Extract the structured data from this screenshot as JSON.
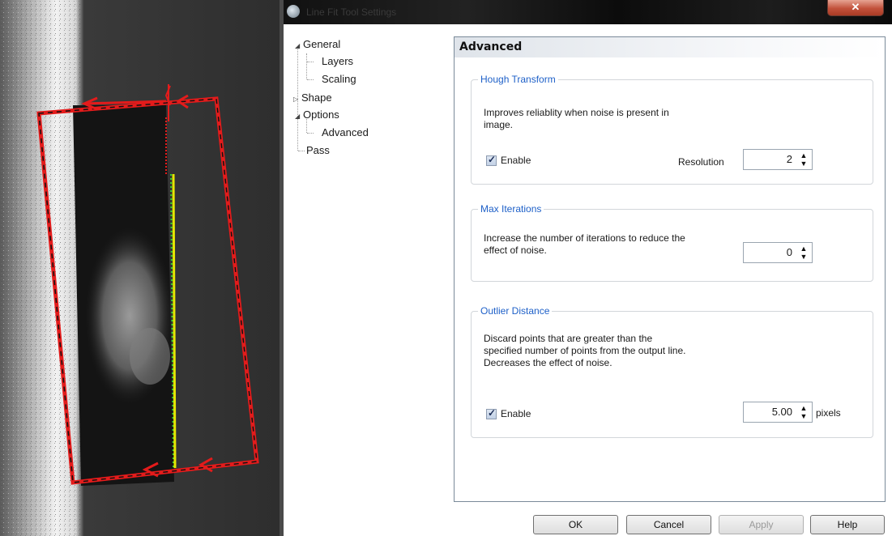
{
  "window": {
    "title": "Line Fit Tool Settings"
  },
  "tree": {
    "items": [
      {
        "label": "General",
        "expanded": true
      },
      {
        "label": "Layers"
      },
      {
        "label": "Scaling"
      },
      {
        "label": "Shape",
        "expanded": false
      },
      {
        "label": "Options",
        "expanded": true
      },
      {
        "label": "Advanced"
      },
      {
        "label": "Pass"
      }
    ]
  },
  "panel": {
    "title": "Advanced",
    "hough": {
      "title": "Hough Transform",
      "description_line1": "Improves reliablity when noise is present in",
      "description_line2": "image.",
      "enable_label": "Enable",
      "enable_checked": true,
      "resolution_label": "Resolution",
      "resolution_value": "2"
    },
    "max_iterations": {
      "title": "Max Iterations",
      "description_line1": "Increase the number of iterations to reduce the",
      "description_line2": "effect of noise.",
      "value": "0"
    },
    "outlier": {
      "title": "Outlier Distance",
      "description_line1": "Discard points that are greater than the",
      "description_line2": "specified number of points from the output line.",
      "description_line3": "Decreases the effect of noise.",
      "enable_label": "Enable",
      "enable_checked": true,
      "value": "5.00",
      "unit": "pixels"
    }
  },
  "buttons": {
    "ok": "OK",
    "cancel": "Cancel",
    "apply": "Apply",
    "help": "Help"
  },
  "colors": {
    "group_title": "#1e60c8",
    "roi_outline": "#e41b1b",
    "edge_points": "#e6e600"
  },
  "icons": [
    "window-app-icon",
    "close-icon",
    "expand-arrow-icon",
    "collapse-arrow-icon",
    "checkmark-icon",
    "spin-up-icon",
    "spin-down-icon"
  ]
}
